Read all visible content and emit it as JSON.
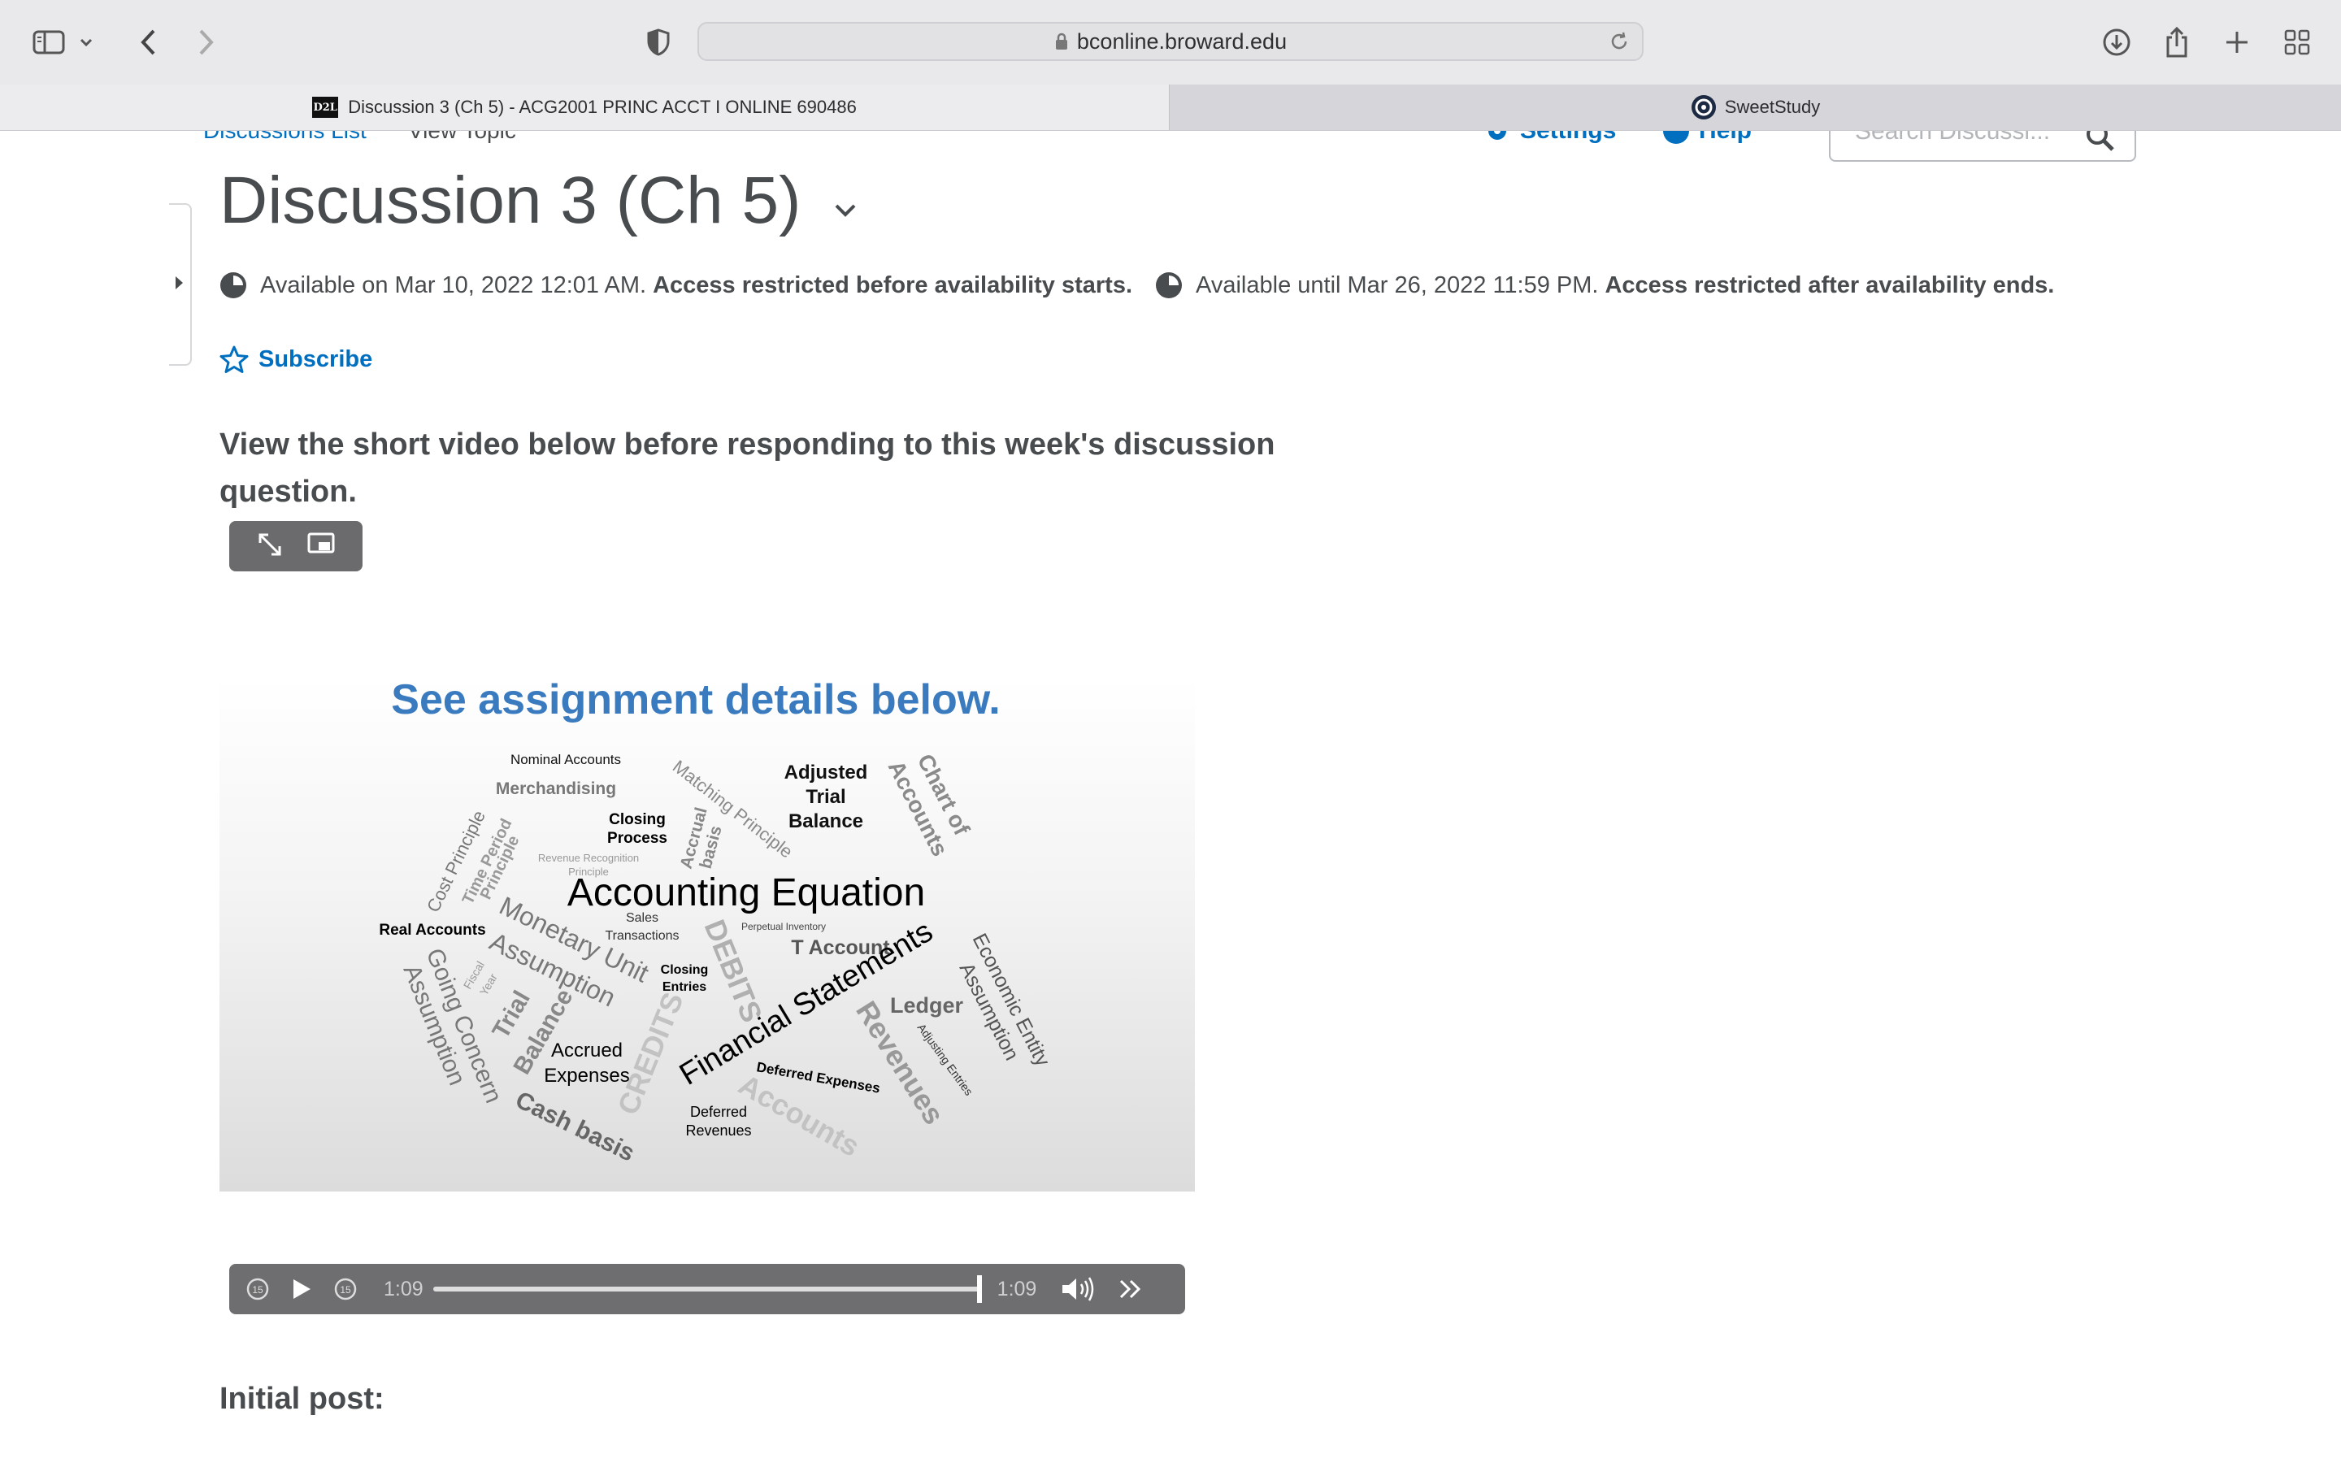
{
  "browser": {
    "url": "bconline.broward.edu",
    "tabs": [
      {
        "label": "Discussion 3 (Ch 5) - ACG2001 PRINC ACCT I ONLINE 690486",
        "favicon": "D2L",
        "active": true
      },
      {
        "label": "SweetStudy",
        "active": false
      }
    ]
  },
  "header": {
    "breadcrumb": [
      "Discussions List",
      "View Topic"
    ],
    "settings_label": "Settings",
    "help_label": "Help",
    "search_placeholder": "Search Discussi..."
  },
  "topic": {
    "title": "Discussion 3 (Ch 5)",
    "available_start": "Available on Mar 10, 2022 12:01 AM.",
    "start_restriction": "Access restricted before availability starts.",
    "available_end": "Available until Mar 26, 2022 11:59 PM.",
    "end_restriction": "Access restricted after availability ends.",
    "subscribe_label": "Subscribe",
    "intro": "View the short video below before responding to this week's discussion question.",
    "initial_post_heading": "Initial post:"
  },
  "video": {
    "banner": "See assignment details below.",
    "words": {
      "w1": "Nominal Accounts",
      "w2": "Merchandising",
      "w3": "Closing",
      "w4": "Process",
      "w5": "Revenue Recognition",
      "w6": "Principle",
      "w7": "Matching Principle",
      "w8": "Adjusted",
      "w9": "Trial",
      "w10": "Balance",
      "w11": "Chart of",
      "w12": "Accounts",
      "w13": "Cost Principle",
      "w14": "Time Period",
      "w15": "Principle",
      "w16": "Accrual",
      "w17": "basis",
      "w18": "Accounting Equation",
      "w19": "Sales",
      "w20": "Transactions",
      "w21": "Perpetual Inventory",
      "w22": "Real Accounts",
      "w23": "Monetary Unit",
      "w24": "Assumption",
      "w25": "T Account",
      "w26": "Economic Entity",
      "w27": "Assumption",
      "w28": "Fiscal",
      "w29": "Year",
      "w30": "Closing",
      "w31": "Entries",
      "w32": "DEBITS",
      "w33": "Financial Statements",
      "w34": "Ledger",
      "w35": "Going Concern",
      "w36": "Assumption",
      "w37": "Trial",
      "w38": "Balance",
      "w39": "Accrued",
      "w40": "Expenses",
      "w41": "CREDITS",
      "w42": "Revenues",
      "w43": "Adjusting Entries",
      "w44": "Deferred Expenses",
      "w45": "Deferred",
      "w46": "Revenues",
      "w47": "Accounts",
      "w48": "Cash basis"
    },
    "current_time": "1:09",
    "duration": "1:09",
    "progress": 1.0
  },
  "colors": {
    "link": "#006fbf",
    "text": "#494c4e",
    "banner": "#3a7bbf"
  }
}
